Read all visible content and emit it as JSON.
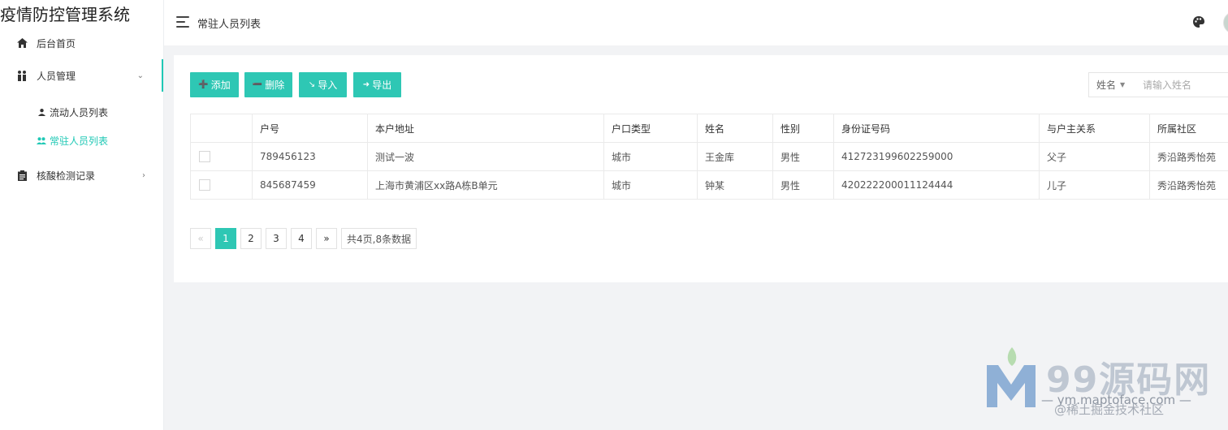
{
  "app": {
    "title": "疫情防控管理系统"
  },
  "sidebar": {
    "items": [
      {
        "label": "后台首页",
        "icon": "home-icon"
      },
      {
        "label": "人员管理",
        "icon": "people-icon",
        "expanded": true,
        "children": [
          {
            "label": "流动人员列表",
            "icon": "person-icon"
          },
          {
            "label": "常驻人员列表",
            "icon": "group-icon",
            "active": true
          }
        ]
      },
      {
        "label": "核酸检测记录",
        "icon": "clipboard-icon"
      }
    ]
  },
  "header": {
    "page_title": "常驻人员列表"
  },
  "toolbar": {
    "add_label": "添加",
    "delete_label": "删除",
    "import_label": "导入",
    "export_label": "导出"
  },
  "search": {
    "field_label": "姓名",
    "placeholder": "请输入姓名"
  },
  "table": {
    "columns": [
      "户号",
      "本户地址",
      "户口类型",
      "姓名",
      "性别",
      "身份证号码",
      "与户主关系",
      "所属社区"
    ],
    "rows": [
      [
        "789456123",
        "测试一波",
        "城市",
        "王金库",
        "男性",
        "412723199602259000",
        "父子",
        "秀沿路秀怡苑"
      ],
      [
        "845687459",
        "上海市黄浦区xx路A栋B单元",
        "城市",
        "钟某",
        "男性",
        "420222200011124444",
        "儿子",
        "秀沿路秀怡苑"
      ]
    ]
  },
  "pagination": {
    "prev": "«",
    "pages": [
      "1",
      "2",
      "3",
      "4"
    ],
    "current": "1",
    "next": "»",
    "summary": "共4页,8条数据"
  },
  "watermark": {
    "text": "99源码网",
    "url": "— ym.maptoface.com —",
    "credit": "@稀土掘金技术社区"
  },
  "colors": {
    "accent": "#2ec7b4",
    "active_text": "#1fc8b5"
  }
}
